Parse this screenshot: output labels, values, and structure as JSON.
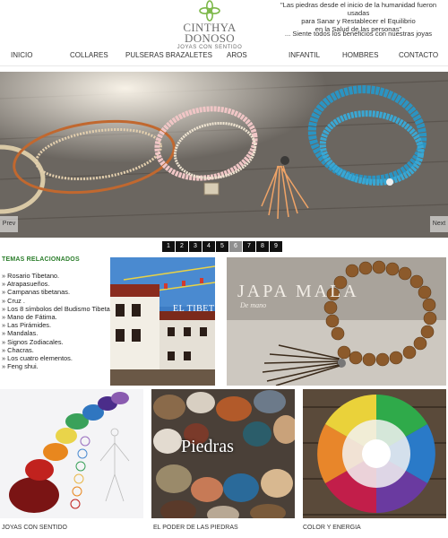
{
  "header": {
    "logo_name": "CINTHYA DONOSO",
    "logo_tagline": "JOYAS CON SENTIDO",
    "quote_line1": "\"Las piedras desde el inicio de la humanidad fueron usadas",
    "quote_line2": "para Sanar y Restablecer el Equilibrio",
    "quote_line3": "en la Salud de las personas\"",
    "quote_link": "... Siente todos los beneficios con nuestras joyas"
  },
  "nav": {
    "items": [
      "INICIO",
      "COLLARES",
      "PULSERAS BRAZALETES",
      "AROS",
      "INFANTIL",
      "HOMBRES",
      "CONTACTO"
    ]
  },
  "slider": {
    "prev_label": "Prev",
    "next_label": "Next",
    "pages": [
      "1",
      "2",
      "3",
      "4",
      "5",
      "6",
      "7",
      "8",
      "9"
    ],
    "active_page": "6"
  },
  "related": {
    "title": "TEMAS RELACIONADOS",
    "items": [
      "Rosario Tibetano.",
      "Atrapasueños.",
      "Campanas tibetanas.",
      "Cruz .",
      "Los 8 símbolos del Budismo Tibetano.",
      "Mano de Fátima.",
      "Las Pirámides.",
      "Mandalas.",
      "Signos Zodiacales.",
      "Chacras.",
      "Los cuatro elementos.",
      "Feng shui."
    ]
  },
  "tiles": {
    "tibet_overlay": "EL TIBET",
    "japa_title": "JAPA MALA",
    "japa_subtitle": "De mano",
    "piedras_overlay": "Piedras",
    "label_joyas": "JOYAS CON SENTIDO",
    "label_piedras": "EL PODER DE LAS PIEDRAS",
    "label_color": "COLOR Y ENERGIA"
  },
  "colors": {
    "related_title": "#2a7d2a",
    "pager_bg": "#111111",
    "pager_active": "#8f8f8f"
  }
}
